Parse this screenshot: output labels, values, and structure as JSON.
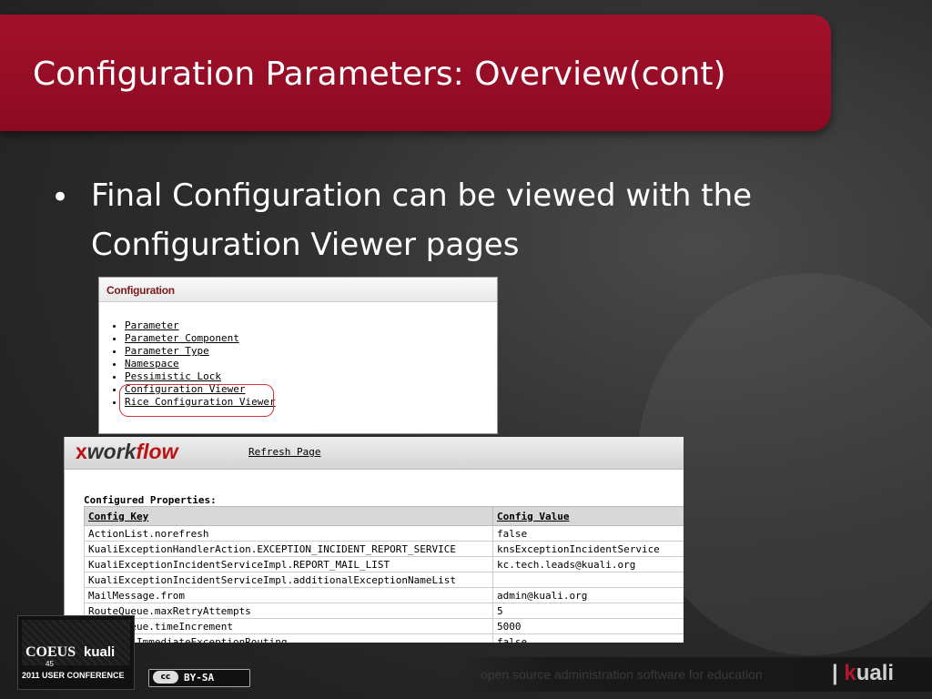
{
  "slide": {
    "title": "Configuration Parameters: Overview(cont)",
    "bullet": "Final Configuration can be viewed with the Configuration Viewer pages"
  },
  "config_panel": {
    "heading": "Configuration",
    "links": [
      "Parameter",
      "Parameter Component",
      "Parameter Type",
      "Namespace",
      "Pessimistic Lock",
      "Configuration Viewer",
      "Rice Configuration Viewer"
    ]
  },
  "workflow": {
    "logo_x": "x",
    "logo_work": "work",
    "logo_flow": "flow",
    "refresh_label": "Refresh Page",
    "section_label": "Configured Properties:",
    "columns": [
      "Config Key",
      "Config Value"
    ],
    "rows": [
      [
        "ActionList.norefresh",
        "false"
      ],
      [
        "KualiExceptionHandlerAction.EXCEPTION_INCIDENT_REPORT_SERVICE",
        "knsExceptionIncidentService"
      ],
      [
        "KualiExceptionIncidentServiceImpl.REPORT_MAIL_LIST",
        "kc.tech.leads@kuali.org"
      ],
      [
        "KualiExceptionIncidentServiceImpl.additionalExceptionNameList",
        ""
      ],
      [
        "MailMessage.from",
        "admin@kuali.org"
      ],
      [
        "RouteQueue.maxRetryAttempts",
        "5"
      ],
      [
        "RouteQueue.timeIncrement",
        "5000"
      ],
      [
        "Routing.ImmediateExceptionRouting",
        "false"
      ]
    ]
  },
  "footer": {
    "tagline": "open source administration software for education",
    "kuali_k": "k",
    "kuali_rest": "uali",
    "coeus": "COEUS",
    "coeus_num": "45",
    "coeus_kuali": "kuali",
    "conference": "2011 USER CONFERENCE",
    "cc_icon": "cc",
    "cc_license": "BY-SA"
  }
}
